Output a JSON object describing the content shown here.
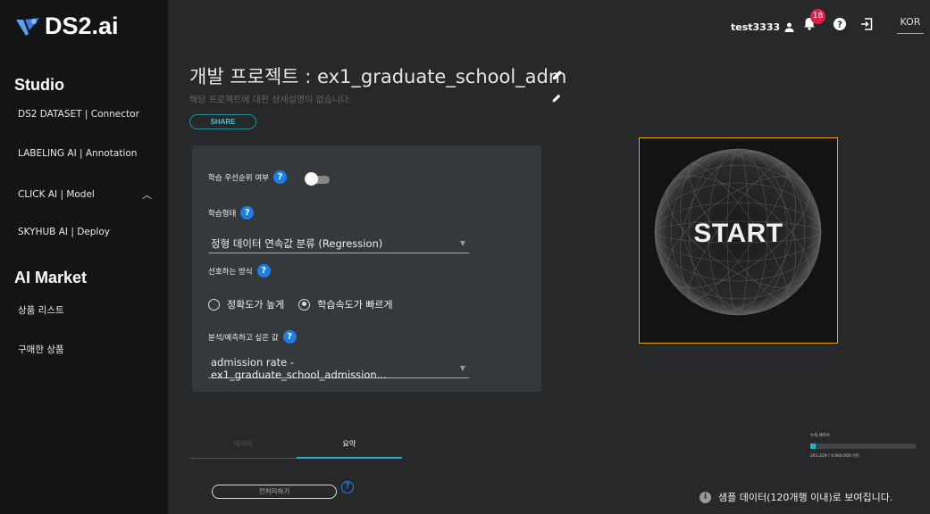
{
  "brand": {
    "name": "DS2.ai"
  },
  "sidebar": {
    "studio_heading": "Studio",
    "studio_items": [
      {
        "label": "DS2 DATASET | Connector"
      },
      {
        "label": "LABELING AI | Annotation"
      },
      {
        "label": "CLICK AI | Model"
      },
      {
        "label": "SKYHUB AI | Deploy"
      }
    ],
    "market_heading": "AI Market",
    "market_items": [
      {
        "label": "상품 리스트"
      },
      {
        "label": "구매한 상품"
      }
    ]
  },
  "topbar": {
    "username": "test3333",
    "notification_count": "18",
    "language": "KOR",
    "icons": [
      "user-icon",
      "bell-icon",
      "help-icon",
      "logout-icon"
    ]
  },
  "project": {
    "title": "개발 프로젝트 : ex1_graduate_school_adm",
    "description": "해당 프로젝트에 대한 상세설명이 없습니다.",
    "share_label": "SHARE"
  },
  "settings": {
    "priority_label": "학습 우선순위 여부",
    "priority_enabled": false,
    "training_type_label": "학습형태",
    "training_type_value": "정형 데이터 연속값 분류 (Regression)",
    "preference_label": "선호하는 방식",
    "preference_options": [
      "정확도가 높게",
      "학습속도가 빠르게"
    ],
    "preference_selected": 1,
    "target_label": "분석/예측하고 싶은 값",
    "target_value": "admission rate - ex1_graduate_school_admission..."
  },
  "start": {
    "label": "START"
  },
  "tabs": [
    {
      "label": "데이터",
      "active": false
    },
    {
      "label": "요약",
      "active": true
    }
  ],
  "preprocess_button": "전처리하기",
  "quota": {
    "label": "누적 예측수",
    "value_text": "261,229 / 4,900,000 (번)",
    "used": 261229,
    "total": 4900000
  },
  "sample_note": "샘플 데이터(120개행 이내)로 보여집니다.",
  "colors": {
    "accent": "#21b3c5",
    "help_blue": "#1a7fe8",
    "start_border": "#f0a020",
    "badge": "#e0204a"
  }
}
